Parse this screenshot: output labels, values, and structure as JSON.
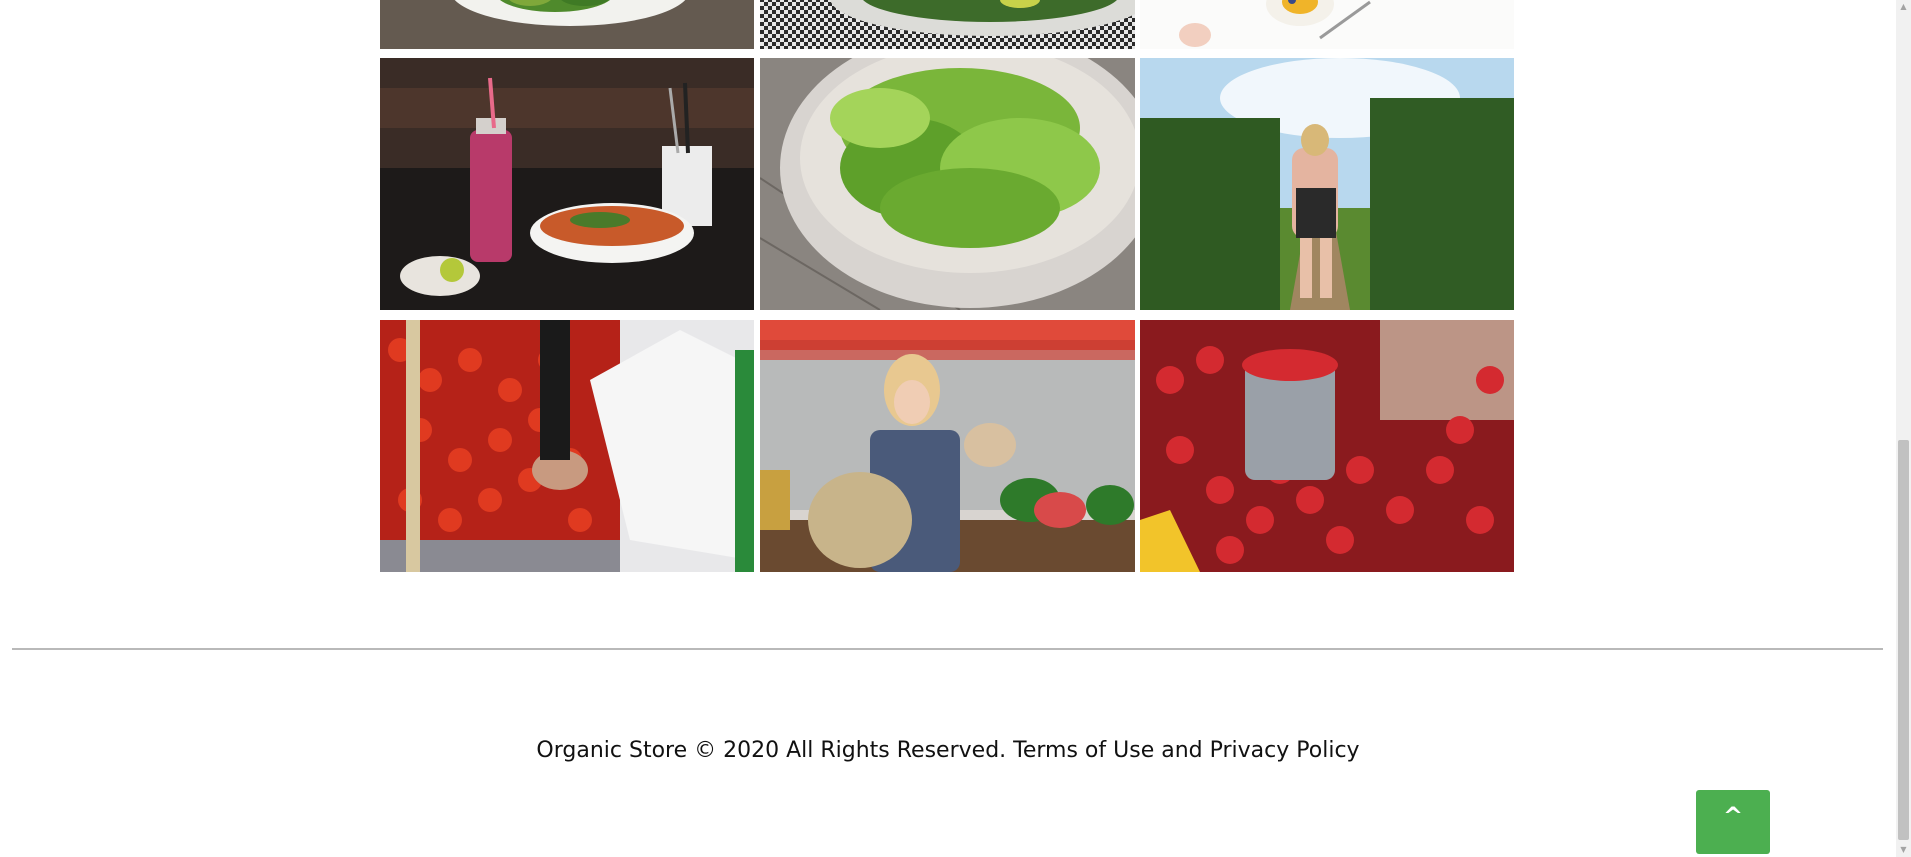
{
  "gallery": {
    "images": [
      {
        "alt": "plate with greens and avocado",
        "icon": "salad-plate-image"
      },
      {
        "alt": "salad on checkered tablecloth",
        "icon": "salad-table-image"
      },
      {
        "alt": "hand with fork and breakfast plate",
        "icon": "breakfast-image"
      },
      {
        "alt": "berry drink and noodle soup",
        "icon": "soup-drink-image"
      },
      {
        "alt": "bowl of lettuce",
        "icon": "lettuce-bowl-image"
      },
      {
        "alt": "woman in vineyard",
        "icon": "vineyard-image"
      },
      {
        "alt": "tomatoes at market stall",
        "icon": "tomatoes-image"
      },
      {
        "alt": "girl at market with basket and watermelons",
        "icon": "market-girl-image"
      },
      {
        "alt": "strawberries in basket",
        "icon": "strawberries-image"
      }
    ]
  },
  "footer": {
    "copyright": "Organic Store © 2020 All Rights Reserved.",
    "terms_link": "Terms of Use",
    "and_text": "and",
    "privacy_link": "Privacy Policy"
  },
  "back_to_top": {
    "label": "^",
    "color": "#4caf50"
  },
  "colors": {
    "background": "#ffffff",
    "divider": "#b9b9b9",
    "text": "#111111"
  }
}
